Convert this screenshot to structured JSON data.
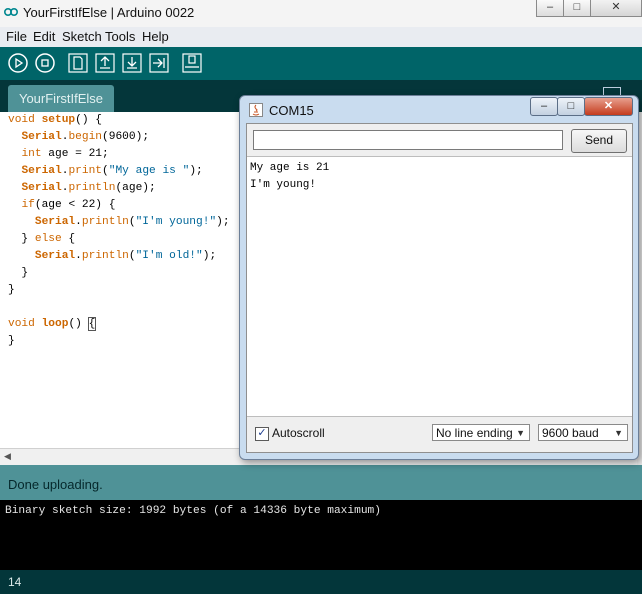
{
  "window": {
    "title": "YourFirstIfElse | Arduino 0022"
  },
  "menu": [
    "File",
    "Edit",
    "Sketch",
    "Tools",
    "Help"
  ],
  "toolbar": {
    "icons": [
      "verify-icon",
      "stop-icon",
      "new-icon",
      "open-icon",
      "save-icon",
      "upload-icon",
      "serial-monitor-icon"
    ]
  },
  "tab": {
    "label": "YourFirstIfElse"
  },
  "code_lines": [
    "void setup() {",
    "  Serial.begin(9600);",
    "  int age = 21;",
    "  Serial.print(\"My age is \");",
    "  Serial.println(age);",
    "  if(age < 22) {",
    "    Serial.println(\"I'm young!\");",
    "  } else {",
    "    Serial.println(\"I'm old!\");",
    "  }",
    "}",
    "",
    "void loop() {",
    "}"
  ],
  "status": {
    "message": "Done uploading."
  },
  "console": {
    "text": "Binary sketch size: 1992 bytes (of a 14336 byte maximum)"
  },
  "footer": {
    "line_number": "14"
  },
  "serial_monitor": {
    "title": "COM15",
    "input_value": "",
    "send_label": "Send",
    "output_lines": [
      "My age is 21",
      "I'm young!"
    ],
    "autoscroll_label": "Autoscroll",
    "autoscroll_checked": true,
    "line_ending": "No line ending",
    "baud": "9600 baud"
  },
  "colors": {
    "toolbar": "#006468",
    "tabbar": "#04363a",
    "status": "#4f9297",
    "keyword": "#cc6600",
    "string": "#006699"
  }
}
